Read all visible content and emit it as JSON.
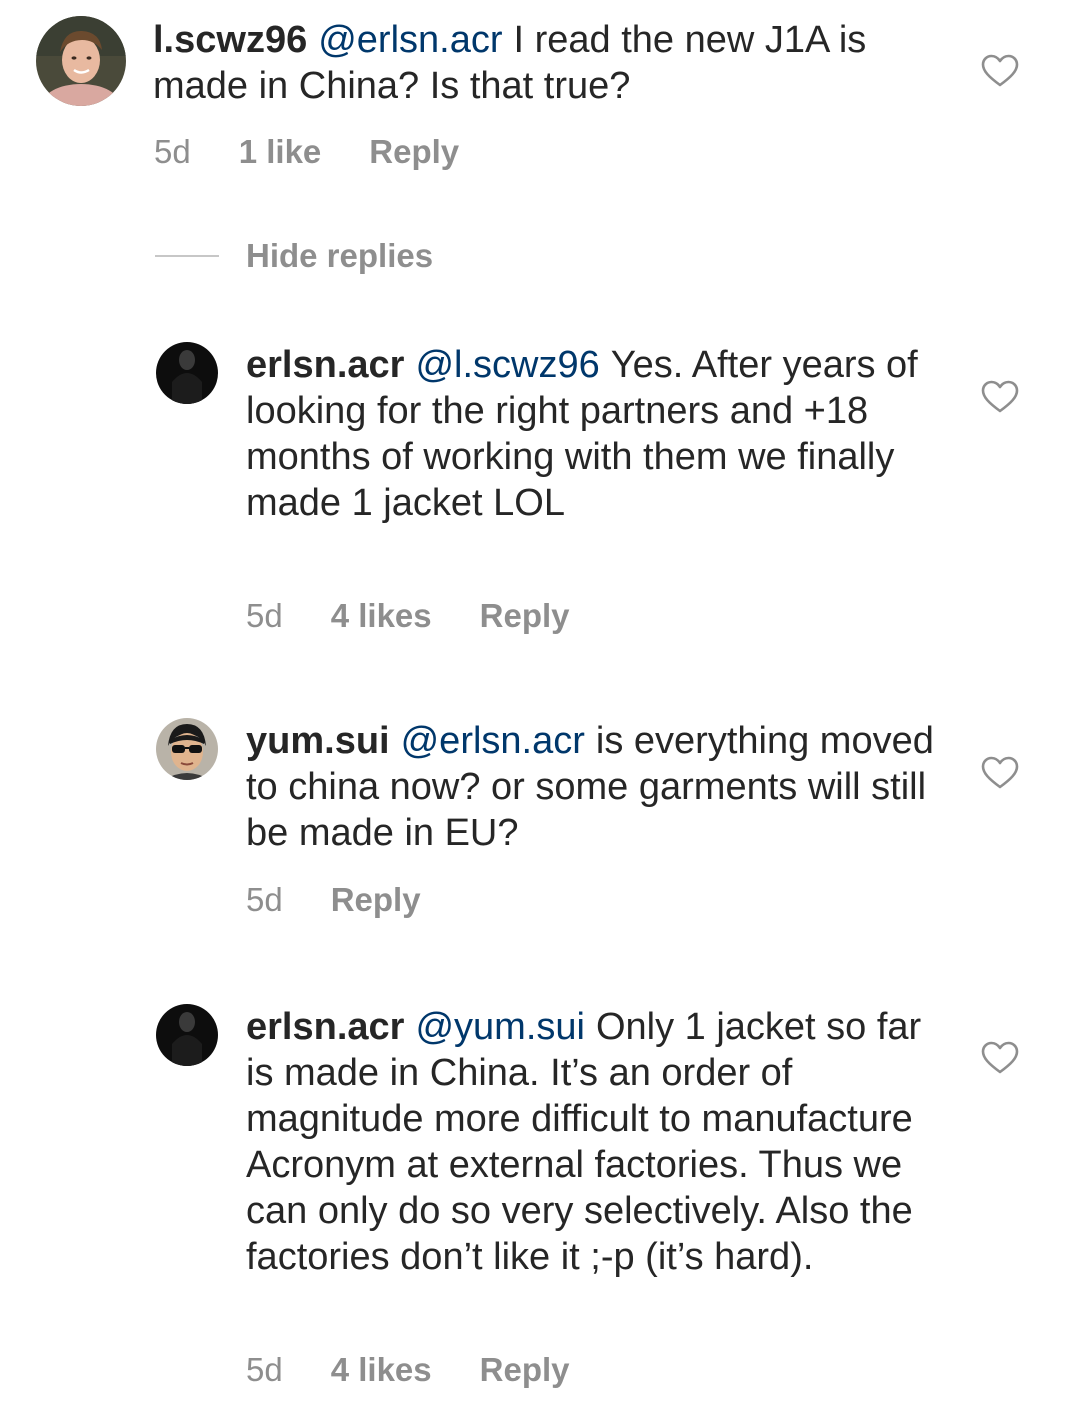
{
  "comments": [
    {
      "username": "l.scwz96",
      "mention": "@erlsn.acr",
      "text": "I read the new J1A is made in China? Is that true?",
      "time": "5d",
      "likes": "1 like",
      "reply": "Reply",
      "avatar_icon": "user-avatar-photo",
      "like_icon": "heart-outline-icon"
    },
    {
      "username": "erlsn.acr",
      "mention": "@l.scwz96",
      "text": "Yes. After years of looking for the right partners and +18 months of working with them we finally made 1 jacket LOL",
      "time": "5d",
      "likes": "4 likes",
      "reply": "Reply",
      "avatar_icon": "user-avatar-dark",
      "like_icon": "heart-outline-icon"
    },
    {
      "username": "yum.sui",
      "mention": "@erlsn.acr",
      "text": "is everything moved to china now? or some garments will still be made in EU?",
      "time": "5d",
      "reply": "Reply",
      "avatar_icon": "user-avatar-sunglasses",
      "like_icon": "heart-outline-icon"
    },
    {
      "username": "erlsn.acr",
      "mention": "@yum.sui",
      "text": "Only 1 jacket so far is made in China. It’s an order of magnitude more difficult to manufacture Acronym at external factories. Thus we can only do so very selectively. Also the factories don’t like it ;-p (it’s hard).",
      "time": "5d",
      "likes": "4 likes",
      "reply": "Reply",
      "avatar_icon": "user-avatar-dark",
      "like_icon": "heart-outline-icon"
    }
  ],
  "hide_replies_label": "Hide replies",
  "colors": {
    "text": "#262626",
    "mention": "#00376b",
    "meta": "#8e8e8e",
    "divider": "#c7c7c7"
  }
}
